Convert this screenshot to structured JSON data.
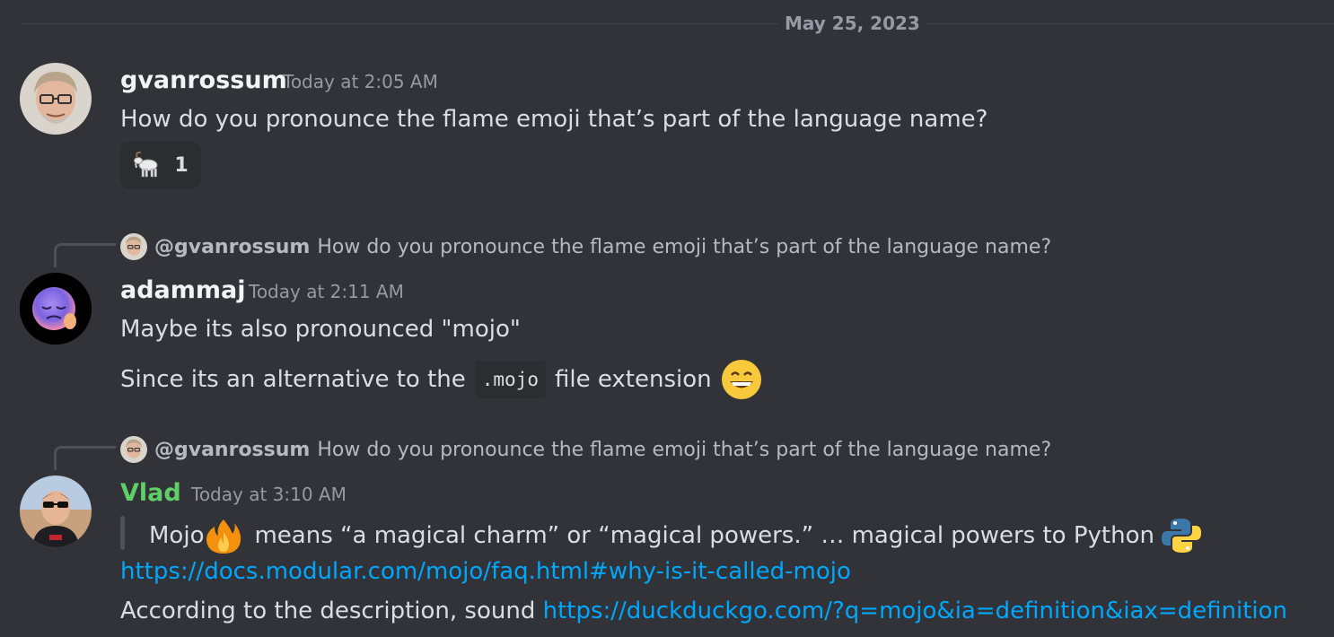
{
  "date_divider": "May 25, 2023",
  "messages": [
    {
      "username": "gvanrossum",
      "timestamp": "Today at 2:05 AM",
      "text": "How do you pronounce the flame emoji that’s part of the language name?",
      "reaction": {
        "emoji": "🐐",
        "count": "1"
      }
    },
    {
      "reply": {
        "mention": "@gvanrossum",
        "text": "How do you pronounce the flame emoji that’s part of the language name?"
      },
      "username": "adammaj",
      "timestamp": "Today at 2:11 AM",
      "line1": "Maybe its also pronounced \"mojo\"",
      "line2_prefix": "Since its an alternative to the",
      "line2_code": ".mojo",
      "line2_suffix": "file extension"
    },
    {
      "reply": {
        "mention": "@gvanrossum",
        "text": "How do you pronounce the flame emoji that’s part of the language name?"
      },
      "username": "Vlad",
      "username_color": "#5fd068",
      "timestamp": "Today at 3:10 AM",
      "quote_prefix": "Mojo",
      "quote_suffix": "means “a magical charm” or “magical powers.” … magical powers to Python",
      "link1": "https://docs.modular.com/mojo/faq.html#why-is-it-called-mojo",
      "line3_prefix": "According to the description, sound",
      "link2": "https://duckduckgo.com/?q=mojo&ia=definition&iax=definition"
    }
  ],
  "icons": {
    "goat": "goat-emoji",
    "fire": "fire-emoji",
    "python": "python-logo",
    "grin": "grinning-emoji"
  },
  "colors": {
    "background": "#313338",
    "link": "#00a8fc",
    "muted": "#949ba4"
  }
}
